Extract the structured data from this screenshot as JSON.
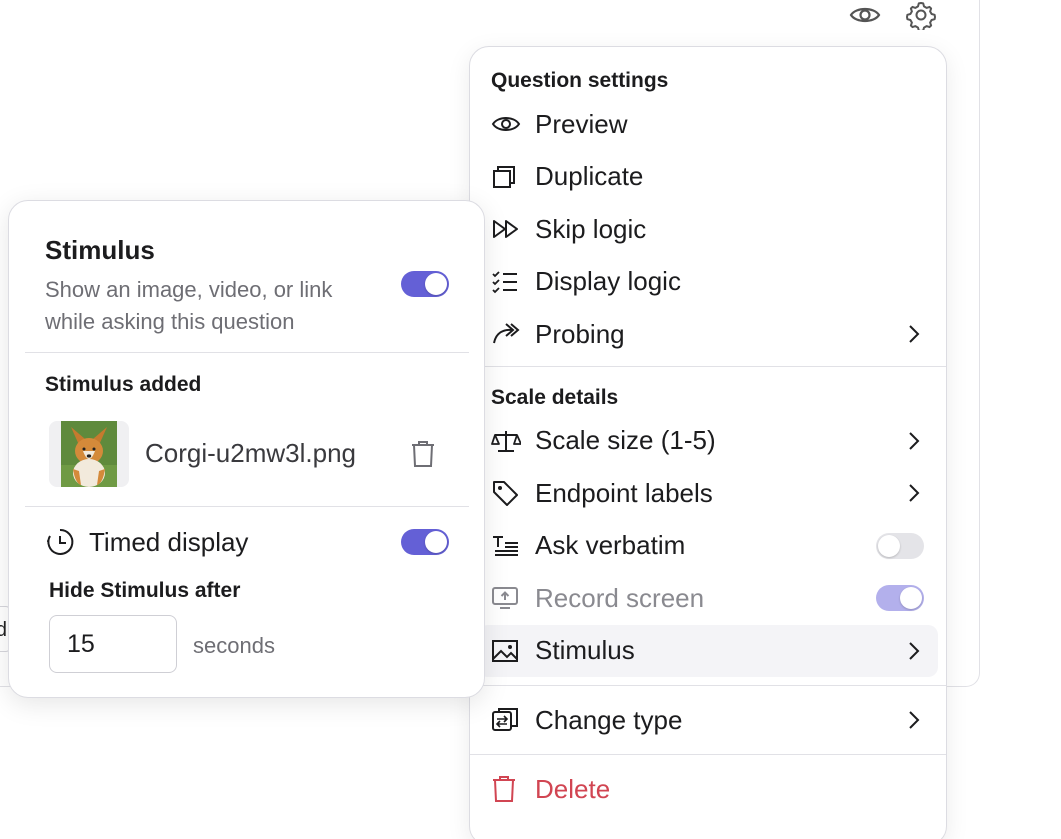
{
  "top_icons": {
    "preview": "eye-icon",
    "settings": "gear-icon"
  },
  "background": {
    "partial_input_text": "d"
  },
  "menu": {
    "sections": [
      {
        "title": "Question settings",
        "items": [
          {
            "label": "Preview",
            "icon": "eye-icon",
            "control": "none"
          },
          {
            "label": "Duplicate",
            "icon": "copy-icon",
            "control": "none"
          },
          {
            "label": "Skip logic",
            "icon": "fast-forward-icon",
            "control": "none"
          },
          {
            "label": "Display logic",
            "icon": "list-check-icon",
            "control": "none"
          },
          {
            "label": "Probing",
            "icon": "share-arrow-icon",
            "control": "chevron"
          }
        ]
      },
      {
        "title": "Scale details",
        "items": [
          {
            "label": "Scale size (1-5)",
            "icon": "scale-icon",
            "control": "chevron"
          },
          {
            "label": "Endpoint labels",
            "icon": "tag-icon",
            "control": "chevron"
          },
          {
            "label": "Ask verbatim",
            "icon": "text-lines-icon",
            "control": "toggle",
            "on": false
          },
          {
            "label": "Record screen",
            "icon": "screen-record-icon",
            "control": "toggle",
            "on": true,
            "disabled": true
          },
          {
            "label": "Stimulus",
            "icon": "image-icon",
            "control": "chevron",
            "active": true
          }
        ]
      }
    ],
    "change_type": "Change type",
    "delete": "Delete"
  },
  "stimulus": {
    "title": "Stimulus",
    "description": "Show an image, video, or link while asking this question",
    "enabled": true,
    "added_heading": "Stimulus added",
    "file_name": "Corgi-u2mw3l.png",
    "timed_label": "Timed display",
    "timed_enabled": true,
    "hide_after_label": "Hide Stimulus after",
    "hide_after_value": "15",
    "hide_after_unit": "seconds"
  },
  "colors": {
    "accent": "#6460d6",
    "danger": "#d14552",
    "text": "#1c1c1e",
    "muted": "#6e6e74"
  }
}
